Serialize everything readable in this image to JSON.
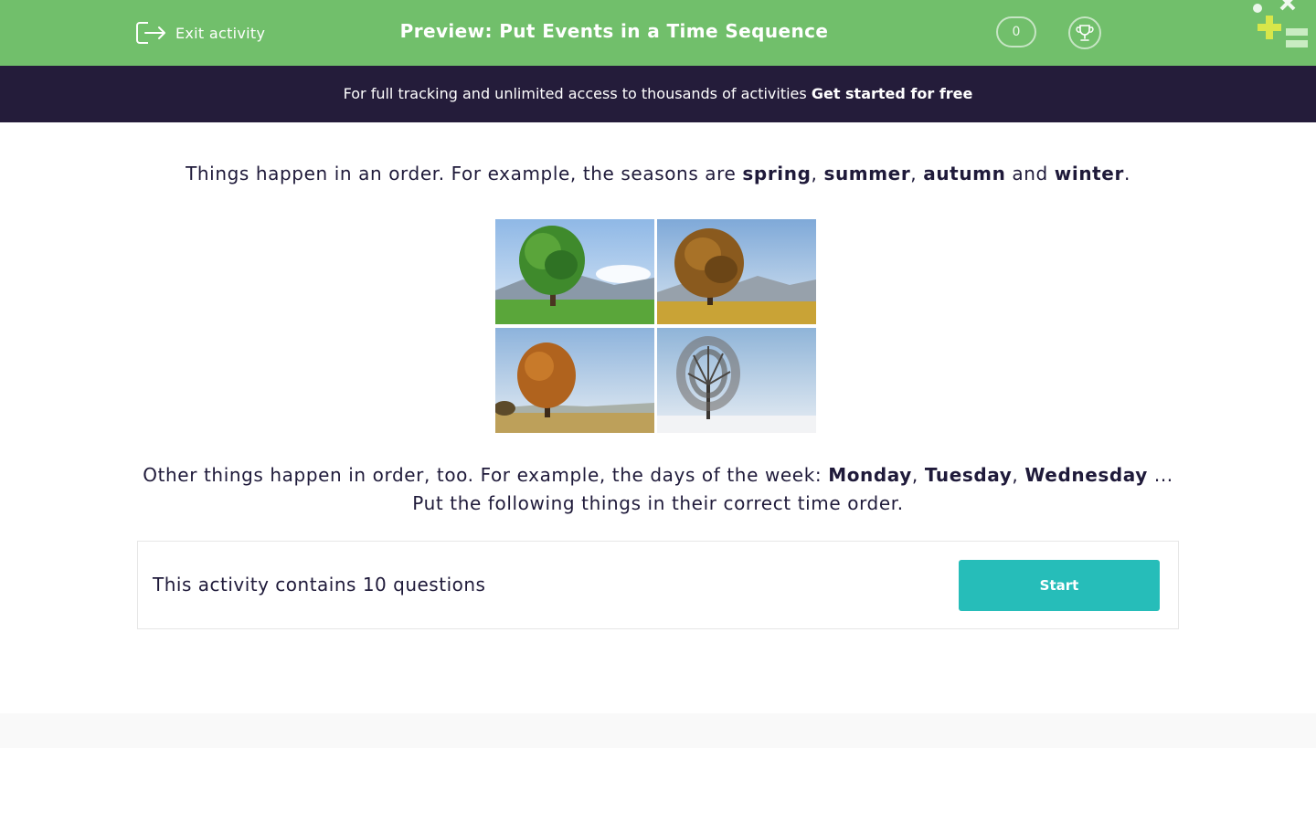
{
  "header": {
    "exit_label": "Exit activity",
    "title": "Preview: Put Events in a Time Sequence",
    "score": "0",
    "colors": {
      "header_bg": "#71bf6b",
      "banner_bg": "#241c3a",
      "accent": "#26bdb9"
    }
  },
  "banner": {
    "text": "For full tracking and unlimited access to thousands of activities ",
    "cta": "Get started for free"
  },
  "intro": {
    "prefix": "Things happen in an order. For example, the seasons are ",
    "spring": "spring",
    "comma1": ", ",
    "summer": "summer",
    "comma2": ", ",
    "autumn": "autumn",
    "and": " and ",
    "winter": "winter",
    "period": "."
  },
  "seasons": [
    "spring tree",
    "summer tree",
    "autumn tree",
    "winter tree"
  ],
  "days": {
    "prefix": "Other things happen in order, too. For example, the days of the week: ",
    "monday": "Monday",
    "comma1": ", ",
    "tuesday": "Tuesday",
    "comma2": ", ",
    "wednesday": "Wednesday",
    "ellipsis": " ...",
    "instruction": "Put the following things in their correct time order."
  },
  "activity": {
    "count_text": "This activity contains 10 questions",
    "start_label": "Start"
  }
}
